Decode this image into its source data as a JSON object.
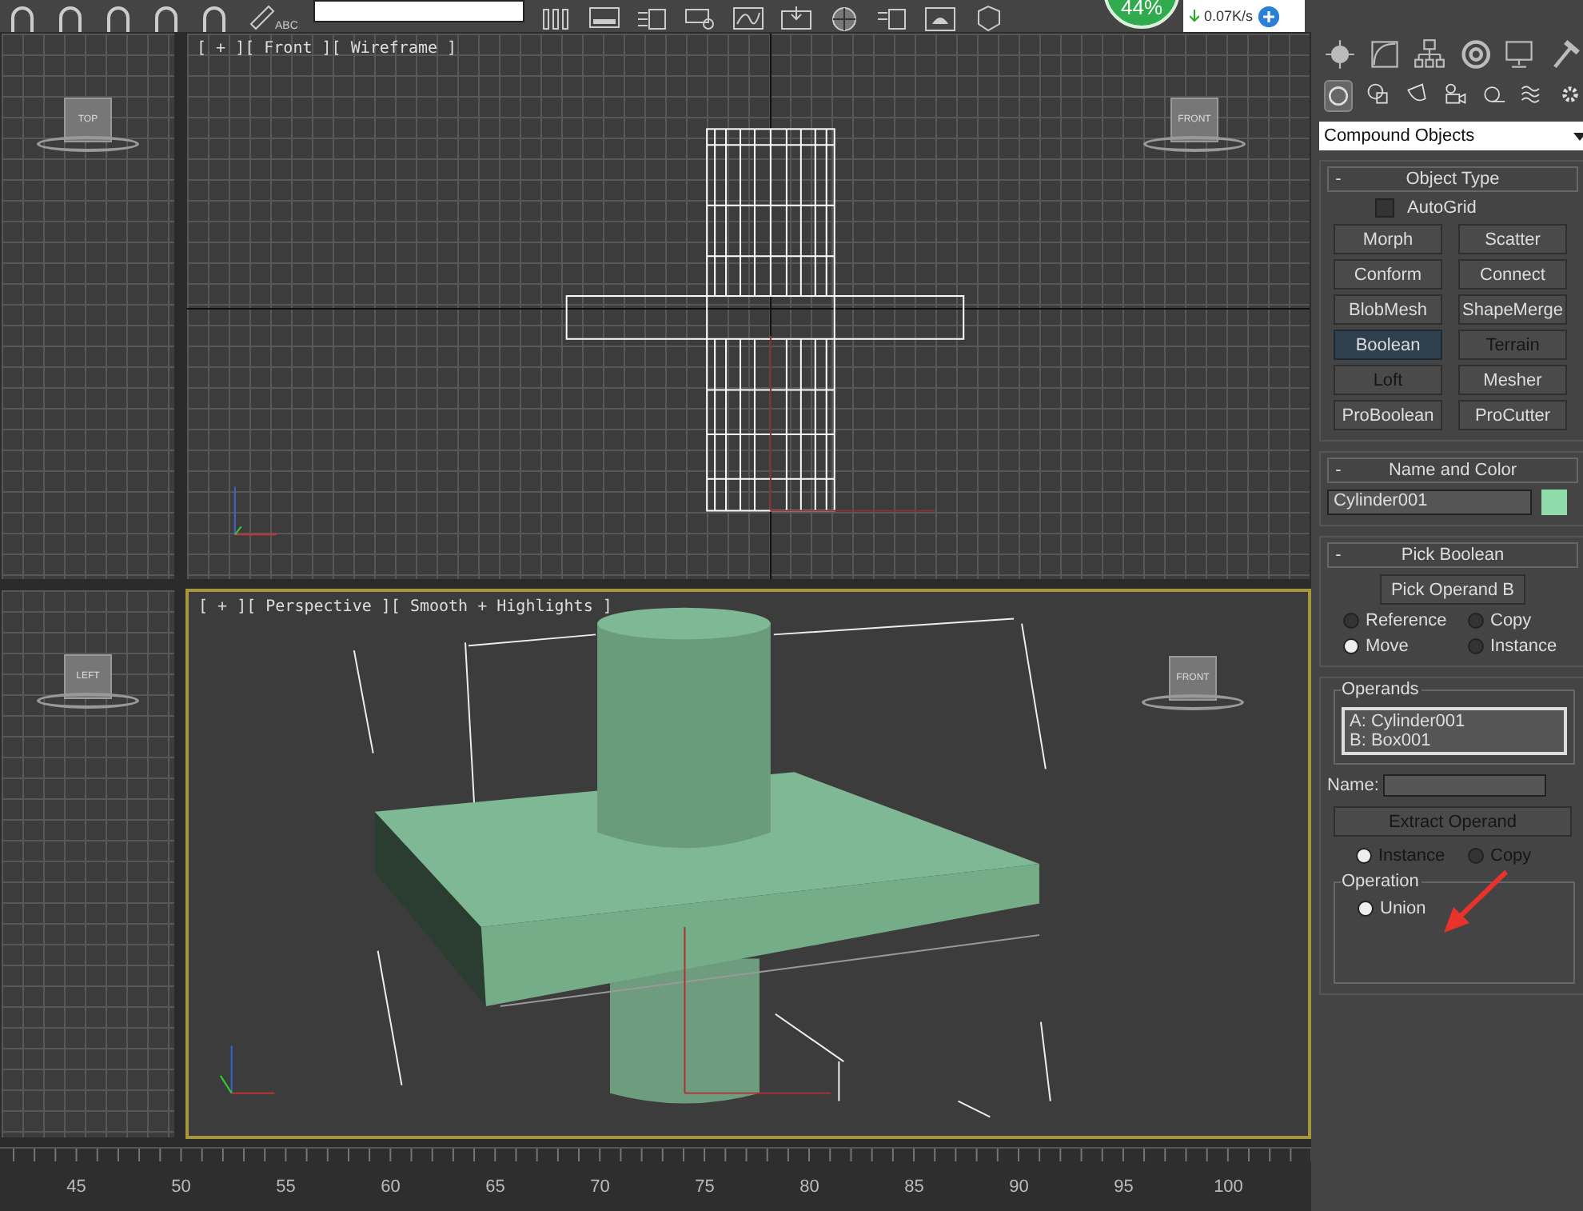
{
  "toolbar": {
    "icon_caption": "ABC"
  },
  "status_widget": {
    "percent": "44%",
    "speed": "0.07K/s"
  },
  "viewports": [
    {
      "kind": "grid",
      "viewcube": "TOP",
      "active": false
    },
    {
      "kind": "wireframe",
      "label": "[ + ][ Front ][ Wireframe ]",
      "viewcube": "FRONT",
      "active": false
    },
    {
      "kind": "grid",
      "viewcube": "LEFT",
      "active": false
    },
    {
      "kind": "shaded",
      "label": "[ + ][ Perspective ][ Smooth + Highlights ]",
      "viewcube": "FRONT",
      "active": true
    }
  ],
  "ruler": {
    "labels": [
      "45",
      "50",
      "55",
      "60",
      "65",
      "70",
      "75",
      "80",
      "85",
      "90",
      "95",
      "100"
    ]
  },
  "command_panel": {
    "categories": [
      {
        "selected": true
      },
      {
        "selected": false
      },
      {
        "selected": false
      },
      {
        "selected": false
      },
      {
        "selected": false
      },
      {
        "selected": false
      },
      {
        "selected": false
      }
    ],
    "dropdown": {
      "value": "Compound Objects"
    },
    "object_type": {
      "toggle": "-",
      "title": "Object Type",
      "autogrid": {
        "label": "AutoGrid",
        "checked": false
      },
      "buttons": [
        {
          "label": "Morph",
          "selected": false,
          "disabled": false
        },
        {
          "label": "Scatter",
          "selected": false,
          "disabled": false
        },
        {
          "label": "Conform",
          "selected": false,
          "disabled": false
        },
        {
          "label": "Connect",
          "selected": false,
          "disabled": false
        },
        {
          "label": "BlobMesh",
          "selected": false,
          "disabled": false
        },
        {
          "label": "ShapeMerge",
          "selected": false,
          "disabled": false
        },
        {
          "label": "Boolean",
          "selected": true,
          "disabled": false
        },
        {
          "label": "Terrain",
          "selected": false,
          "disabled": true
        },
        {
          "label": "Loft",
          "selected": false,
          "disabled": true
        },
        {
          "label": "Mesher",
          "selected": false,
          "disabled": false
        },
        {
          "label": "ProBoolean",
          "selected": false,
          "disabled": false
        },
        {
          "label": "ProCutter",
          "selected": false,
          "disabled": false
        }
      ]
    },
    "name_and_color": {
      "toggle": "-",
      "title": "Name and Color",
      "name": "Cylinder001",
      "color": "#8fdcaa"
    },
    "pick_boolean": {
      "toggle": "-",
      "title": "Pick Boolean",
      "button": "Pick Operand B",
      "options": [
        {
          "label": "Reference",
          "selected": false
        },
        {
          "label": "Copy",
          "selected": false
        },
        {
          "label": "Move",
          "selected": true
        },
        {
          "label": "Instance",
          "selected": false
        }
      ]
    },
    "parameters": {
      "operands_title": "Operands",
      "operands": [
        "A: Cylinder001",
        "B: Box001"
      ],
      "name_label": "Name:",
      "extract": {
        "label": "Extract Operand",
        "disabled": true
      },
      "extract_options": [
        {
          "label": "Instance",
          "selected": true
        },
        {
          "label": "Copy",
          "selected": false
        }
      ],
      "operation_title": "Operation",
      "operations": [
        {
          "label": "Union",
          "selected": true
        }
      ]
    }
  }
}
